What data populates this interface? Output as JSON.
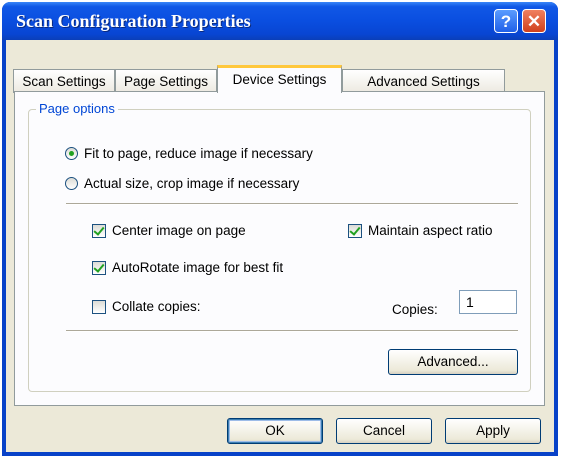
{
  "window": {
    "title": "Scan Configuration Properties",
    "help_glyph": "?",
    "close_glyph": "✕"
  },
  "tabs": [
    {
      "label": "Scan Settings"
    },
    {
      "label": "Page Settings"
    },
    {
      "label": "Device Settings",
      "active": true
    },
    {
      "label": "Advanced Settings"
    }
  ],
  "page_options": {
    "legend": "Page options",
    "radios": [
      {
        "label": "Fit to page, reduce image if necessary",
        "selected": true
      },
      {
        "label": "Actual size, crop image if necessary",
        "selected": false
      }
    ],
    "checkboxes": {
      "center": {
        "label": "Center image on page",
        "checked": true
      },
      "aspect": {
        "label": "Maintain aspect ratio",
        "checked": true
      },
      "autorotate": {
        "label": "AutoRotate image for best fit",
        "checked": true
      },
      "collate": {
        "label": "Collate copies:",
        "checked": false
      }
    },
    "copies": {
      "label": "Copies:",
      "value": "1"
    },
    "advanced_button": "Advanced..."
  },
  "footer": {
    "ok": "OK",
    "cancel": "Cancel",
    "apply": "Apply"
  }
}
